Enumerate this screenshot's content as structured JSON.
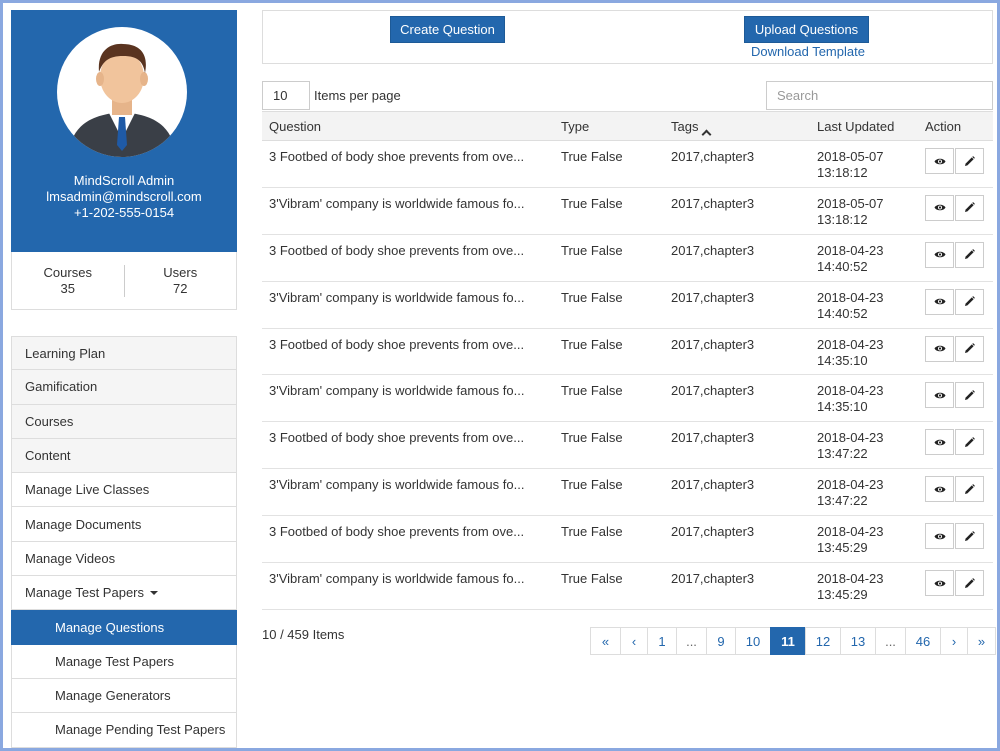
{
  "profile": {
    "name": "MindScroll Admin",
    "email": "lmsadmin@mindscroll.com",
    "phone": "+1-202-555-0154"
  },
  "stats": {
    "courses_label": "Courses",
    "courses_value": "35",
    "users_label": "Users",
    "users_value": "72"
  },
  "nav": [
    "Learning Plan",
    "Gamification",
    "Courses",
    "Content",
    "Manage Live Classes",
    "Manage Documents",
    "Manage Videos",
    "Manage Test Papers",
    "Manage Questions",
    "Manage Test Papers",
    "Manage Generators",
    "Manage Pending Test Papers"
  ],
  "toolbar": {
    "create_label": "Create Question",
    "upload_label": "Upload Questions",
    "download_label": "Download Template"
  },
  "list_controls": {
    "items_per_page_value": "10",
    "items_per_page_label": "Items per page",
    "search_placeholder": "Search"
  },
  "table": {
    "columns": [
      "Question",
      "Type",
      "Tags",
      "Last Updated",
      "Action"
    ],
    "rows": [
      {
        "question": "3 Footbed of body shoe prevents from ove...",
        "type": "True False",
        "tags": "2017,chapter3",
        "date": "2018-05-07",
        "time": "13:18:12"
      },
      {
        "question": "3'Vibram' company is worldwide famous fo...",
        "type": "True False",
        "tags": "2017,chapter3",
        "date": "2018-05-07",
        "time": "13:18:12"
      },
      {
        "question": "3 Footbed of body shoe prevents from ove...",
        "type": "True False",
        "tags": "2017,chapter3",
        "date": "2018-04-23",
        "time": "14:40:52"
      },
      {
        "question": "3'Vibram' company is worldwide famous fo...",
        "type": "True False",
        "tags": "2017,chapter3",
        "date": "2018-04-23",
        "time": "14:40:52"
      },
      {
        "question": "3 Footbed of body shoe prevents from ove...",
        "type": "True False",
        "tags": "2017,chapter3",
        "date": "2018-04-23",
        "time": "14:35:10"
      },
      {
        "question": "3'Vibram' company is worldwide famous fo...",
        "type": "True False",
        "tags": "2017,chapter3",
        "date": "2018-04-23",
        "time": "14:35:10"
      },
      {
        "question": "3 Footbed of body shoe prevents from ove...",
        "type": "True False",
        "tags": "2017,chapter3",
        "date": "2018-04-23",
        "time": "13:47:22"
      },
      {
        "question": "3'Vibram' company is worldwide famous fo...",
        "type": "True False",
        "tags": "2017,chapter3",
        "date": "2018-04-23",
        "time": "13:47:22"
      },
      {
        "question": "3 Footbed of body shoe prevents from ove...",
        "type": "True False",
        "tags": "2017,chapter3",
        "date": "2018-04-23",
        "time": "13:45:29"
      },
      {
        "question": "3'Vibram' company is worldwide famous fo...",
        "type": "True False",
        "tags": "2017,chapter3",
        "date": "2018-04-23",
        "time": "13:45:29"
      }
    ]
  },
  "footer": {
    "total": "10 / 459 Items"
  },
  "pagination": [
    "«",
    "‹",
    "1",
    "...",
    "9",
    "10",
    "11",
    "12",
    "13",
    "...",
    "46",
    "›",
    "»"
  ],
  "pagination_active": "11",
  "icons": {
    "view": "eye-icon",
    "edit": "pencil-icon",
    "sort": "chevron-up-icon",
    "caret": "caret-down-icon"
  },
  "colors": {
    "brand": "#2367ad",
    "frame": "#8aa8e0"
  }
}
